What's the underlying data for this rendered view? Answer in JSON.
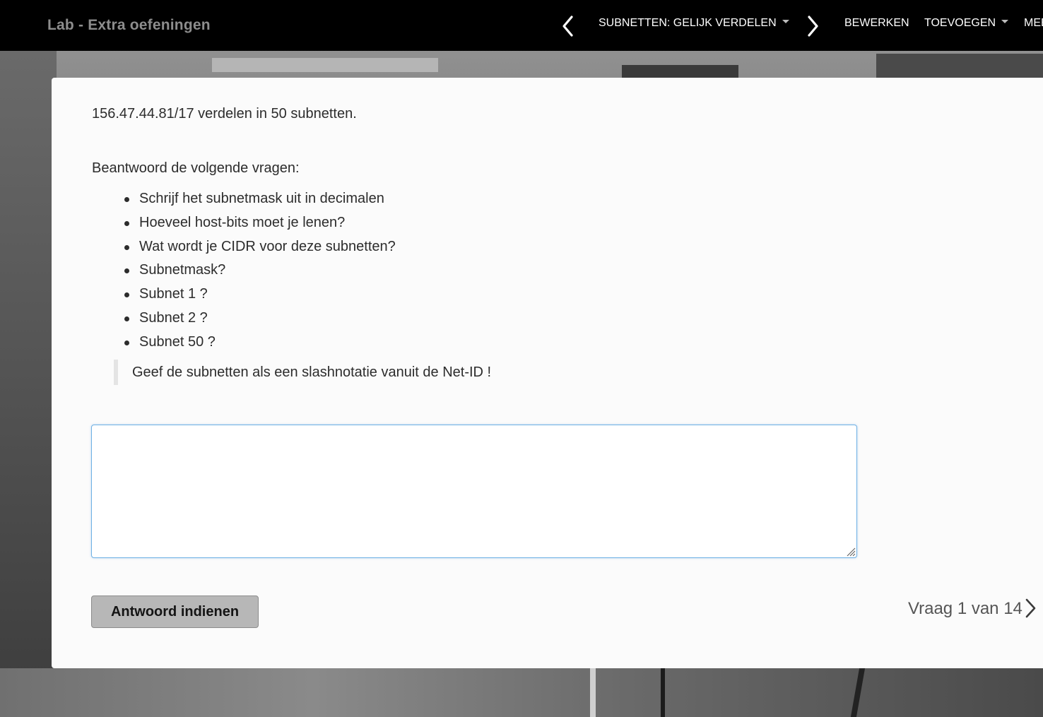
{
  "navbar": {
    "brand": "Lab - Extra oefeningen",
    "section": "SUBNETTEN: GELIJK VERDELEN",
    "edit": "BEWERKEN",
    "add": "TOEVOEGEN",
    "more": "MEER"
  },
  "exercise": {
    "intro": "156.47.44.81/17 verdelen in 50 subnetten.",
    "lead": "Beantwoord de volgende vragen:",
    "questions": [
      "Schrijf het subnetmask uit in decimalen",
      "Hoeveel host-bits moet je lenen?",
      "Wat wordt je CIDR voor deze subnetten?",
      "Subnetmask?",
      "Subnet 1 ?",
      "Subnet 2 ?",
      "Subnet 50 ?"
    ],
    "note": "Geef de subnetten als een slashnotatie vanuit de Net-ID !",
    "answer_value": ""
  },
  "actions": {
    "submit_label": "Antwoord indienen"
  },
  "pager": {
    "label": "Vraag 1 van 14"
  },
  "icons": {
    "prev": "chevron-left-icon",
    "next": "chevron-right-icon",
    "dropdown": "caret-down-icon"
  }
}
